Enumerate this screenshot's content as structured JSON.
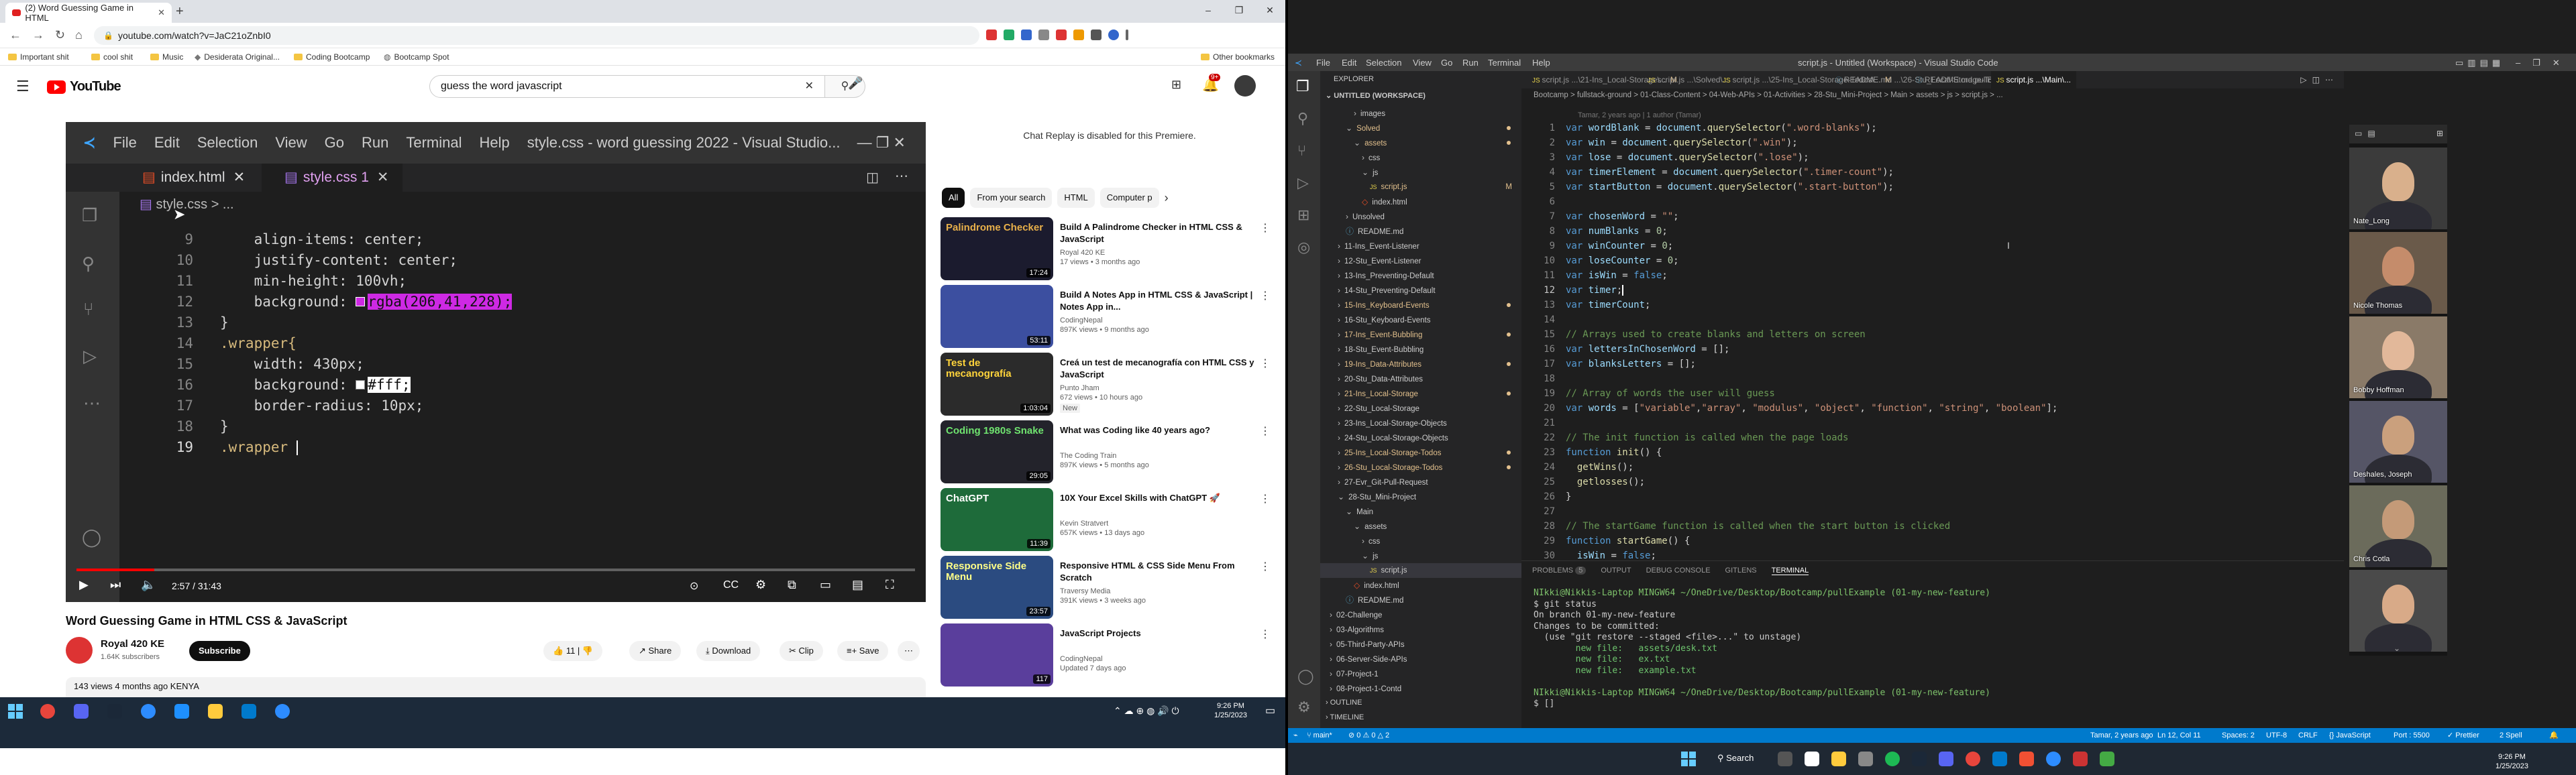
{
  "browser": {
    "tab_title": "(2) Word Guessing Game in HTML",
    "url": "youtube.com/watch?v=JaC21oZnbI0",
    "bookmarks": [
      "Important shit",
      "cool shit",
      "Music",
      "Desiderata Original...",
      "Coding Bootcamp",
      "Bootcamp Spot"
    ],
    "other_bookmarks": "Other bookmarks"
  },
  "youtube": {
    "search_query": "guess the word javascript",
    "logo_text": "YouTube",
    "notif_count": "9+",
    "video": {
      "title": "Word Guessing Game in HTML CSS & JavaScript",
      "time": "2:57 / 31:43",
      "progress": 0.093,
      "channel": "Royal 420 KE",
      "subs": "1.64K subscribers",
      "subscribe": "Subscribe",
      "likes": "11",
      "share": "Share",
      "download": "Download",
      "clip": "Clip",
      "save": "Save",
      "desc_line": "143 views  4 months ago  KENYA",
      "editor": {
        "title": "style.css - word guessing 2022 - Visual Studio...",
        "menus": [
          "File",
          "Edit",
          "Selection",
          "View",
          "Go",
          "Run",
          "Terminal",
          "Help"
        ],
        "tab1": "index.html",
        "tab2": "style.css",
        "tab2_badge": "1",
        "crumb": "style.css > ...",
        "line_numbers": [
          "9",
          "10",
          "11",
          "12",
          "13",
          "14",
          "15",
          "16",
          "17",
          "18",
          "19"
        ],
        "code_lines": [
          "    align-items: center;",
          "    justify-content: center;",
          "    min-height: 100vh;",
          "    background: ",
          "}",
          ".wrapper{",
          "    width: 430px;",
          "    background: ",
          "    border-radius: 10px;",
          "}",
          ".wrapper "
        ],
        "rgba_value": "rgba(206,41,228);",
        "hex_value": "#fff;"
      }
    },
    "chat_replay": "Chat Replay is disabled for this Premiere.",
    "chips": [
      "All",
      "From your search",
      "HTML",
      "Computer p"
    ],
    "recommendations": [
      {
        "title": "Build A Palindrome Checker in HTML CSS & JavaScript",
        "channel": "Royal 420 KE",
        "meta": "17 views • 3 months ago",
        "duration": "17:24",
        "thumb_text": "Palindrome Checker"
      },
      {
        "title": "Build A Notes App in HTML CSS & JavaScript | Notes App in...",
        "channel": "CodingNepal",
        "meta": "897K views • 9 months ago",
        "duration": "53:11",
        "thumb_text": ""
      },
      {
        "title": "Creá un test de mecanografía con HTML CSS y JavaScript",
        "channel": "Punto Jham",
        "meta": "672 views • 10 hours ago",
        "duration": "1:03:04",
        "badge": "New",
        "thumb_text": "Test de mecanografía"
      },
      {
        "title": "What was Coding like 40 years ago?",
        "channel": "The Coding Train",
        "meta": "897K views • 5 months ago",
        "duration": "29:05",
        "thumb_text": "Coding 1980s Snake"
      },
      {
        "title": "10X Your Excel Skills with ChatGPT 🚀",
        "channel": "Kevin Stratvert",
        "meta": "657K views • 13 days ago",
        "duration": "11:39",
        "thumb_text": "ChatGPT"
      },
      {
        "title": "Responsive HTML & CSS Side Menu From Scratch",
        "channel": "Traversy Media",
        "meta": "391K views • 3 weeks ago",
        "duration": "23:57",
        "thumb_text": "Responsive Side Menu"
      },
      {
        "title": "JavaScript Projects",
        "channel": "CodingNepal",
        "meta": "Updated 7 days ago",
        "duration": "117",
        "thumb_text": ""
      }
    ]
  },
  "taskbar_left": {
    "time": "9:26 PM",
    "date": "1/25/2023"
  },
  "vscode": {
    "title": "script.js - Untitled (Workspace) - Visual Studio Code",
    "menus": [
      "File",
      "Edit",
      "Selection",
      "View",
      "Go",
      "Run",
      "Terminal",
      "Help"
    ],
    "explorer_header": "EXPLORER",
    "workspace": "UNTITLED (WORKSPACE)",
    "tree": [
      {
        "label": "images",
        "depth": 3,
        "kind": "folder"
      },
      {
        "label": "Solved",
        "depth": 2,
        "kind": "folder-open",
        "color": "#e2c08d"
      },
      {
        "label": "assets",
        "depth": 3,
        "kind": "folder-open",
        "color": "#e2c08d"
      },
      {
        "label": "css",
        "depth": 4,
        "kind": "folder"
      },
      {
        "label": "js",
        "depth": 4,
        "kind": "folder-open"
      },
      {
        "label": "script.js",
        "depth": 5,
        "kind": "js",
        "color": "#e2c08d",
        "mark": "M"
      },
      {
        "label": "index.html",
        "depth": 4,
        "kind": "html"
      },
      {
        "label": "Unsolved",
        "depth": 2,
        "kind": "folder"
      },
      {
        "label": "README.md",
        "depth": 2,
        "kind": "md"
      },
      {
        "label": "11-Ins_Event-Listener",
        "depth": 1,
        "kind": "folder"
      },
      {
        "label": "12-Stu_Event-Listener",
        "depth": 1,
        "kind": "folder"
      },
      {
        "label": "13-Ins_Preventing-Default",
        "depth": 1,
        "kind": "folder"
      },
      {
        "label": "14-Stu_Preventing-Default",
        "depth": 1,
        "kind": "folder"
      },
      {
        "label": "15-Ins_Keyboard-Events",
        "depth": 1,
        "kind": "folder",
        "color": "#e2c08d"
      },
      {
        "label": "16-Stu_Keyboard-Events",
        "depth": 1,
        "kind": "folder"
      },
      {
        "label": "17-Ins_Event-Bubbling",
        "depth": 1,
        "kind": "folder",
        "color": "#e2c08d"
      },
      {
        "label": "18-Stu_Event-Bubbling",
        "depth": 1,
        "kind": "folder"
      },
      {
        "label": "19-Ins_Data-Attributes",
        "depth": 1,
        "kind": "folder",
        "color": "#e2c08d"
      },
      {
        "label": "20-Stu_Data-Attributes",
        "depth": 1,
        "kind": "folder"
      },
      {
        "label": "21-Ins_Local-Storage",
        "depth": 1,
        "kind": "folder",
        "color": "#e2c08d"
      },
      {
        "label": "22-Stu_Local-Storage",
        "depth": 1,
        "kind": "folder"
      },
      {
        "label": "23-Ins_Local-Storage-Objects",
        "depth": 1,
        "kind": "folder"
      },
      {
        "label": "24-Stu_Local-Storage-Objects",
        "depth": 1,
        "kind": "folder"
      },
      {
        "label": "25-Ins_Local-Storage-Todos",
        "depth": 1,
        "kind": "folder",
        "color": "#e2c08d"
      },
      {
        "label": "26-Stu_Local-Storage-Todos",
        "depth": 1,
        "kind": "folder",
        "color": "#e2c08d"
      },
      {
        "label": "27-Evr_Git-Pull-Request",
        "depth": 1,
        "kind": "folder"
      },
      {
        "label": "28-Stu_Mini-Project",
        "depth": 1,
        "kind": "folder-open"
      },
      {
        "label": "Main",
        "depth": 2,
        "kind": "folder-open"
      },
      {
        "label": "assets",
        "depth": 3,
        "kind": "folder-open"
      },
      {
        "label": "css",
        "depth": 4,
        "kind": "folder"
      },
      {
        "label": "js",
        "depth": 4,
        "kind": "folder-open"
      },
      {
        "label": "script.js",
        "depth": 5,
        "kind": "js",
        "active": true
      },
      {
        "label": "index.html",
        "depth": 3,
        "kind": "html"
      },
      {
        "label": "README.md",
        "depth": 2,
        "kind": "md"
      },
      {
        "label": "02-Challenge",
        "depth": 0,
        "kind": "folder"
      },
      {
        "label": "03-Algorithms",
        "depth": 0,
        "kind": "folder"
      },
      {
        "label": "05-Third-Party-APIs",
        "depth": 0,
        "kind": "folder"
      },
      {
        "label": "06-Server-Side-APIs",
        "depth": 0,
        "kind": "folder"
      },
      {
        "label": "07-Project-1",
        "depth": 0,
        "kind": "folder"
      },
      {
        "label": "08-Project-1-Contd",
        "depth": 0,
        "kind": "folder"
      }
    ],
    "outline": "OUTLINE",
    "timeline": "TIMELINE",
    "tabs": [
      {
        "label": "script.js ...\\21-Ins_Local-Storage\\...",
        "mark": "M"
      },
      {
        "label": "script.js ...\\Solved\\...",
        "mark": ""
      },
      {
        "label": "script.js ...\\25-Ins_Local-Storage-Todos\\...",
        "mark": "M"
      },
      {
        "label": "README.md ...\\26-Stu_Local-Storage-Todos",
        "mark": "1"
      },
      {
        "label": "README.md  pullExample",
        "mark": "4"
      },
      {
        "label": "script.js ...\\Main\\...",
        "mark": "",
        "active": true
      }
    ],
    "breadcrumb": "Bootcamp > fullstack-ground > 01-Class-Content > 04-Web-APIs > 01-Activities > 28-Stu_Mini-Project > Main > assets > js > script.js > ...",
    "blame": "Tamar, 2 years ago | 1 author (Tamar)",
    "code": [
      [
        [
          "kw",
          "var "
        ],
        [
          "id",
          "wordBlank"
        ],
        [
          "pu",
          " = "
        ],
        [
          "id",
          "document"
        ],
        [
          "pu",
          "."
        ],
        [
          "fn",
          "querySelector"
        ],
        [
          "pu",
          "("
        ],
        [
          "st",
          "\".word-blanks\""
        ],
        [
          "pu",
          ");"
        ]
      ],
      [
        [
          "kw",
          "var "
        ],
        [
          "id",
          "win"
        ],
        [
          "pu",
          " = "
        ],
        [
          "id",
          "document"
        ],
        [
          "pu",
          "."
        ],
        [
          "fn",
          "querySelector"
        ],
        [
          "pu",
          "("
        ],
        [
          "st",
          "\".win\""
        ],
        [
          "pu",
          ");"
        ]
      ],
      [
        [
          "kw",
          "var "
        ],
        [
          "id",
          "lose"
        ],
        [
          "pu",
          " = "
        ],
        [
          "id",
          "document"
        ],
        [
          "pu",
          "."
        ],
        [
          "fn",
          "querySelector"
        ],
        [
          "pu",
          "("
        ],
        [
          "st",
          "\".lose\""
        ],
        [
          "pu",
          ");"
        ]
      ],
      [
        [
          "kw",
          "var "
        ],
        [
          "id",
          "timerElement"
        ],
        [
          "pu",
          " = "
        ],
        [
          "id",
          "document"
        ],
        [
          "pu",
          "."
        ],
        [
          "fn",
          "querySelector"
        ],
        [
          "pu",
          "("
        ],
        [
          "st",
          "\".timer-count\""
        ],
        [
          "pu",
          ");"
        ]
      ],
      [
        [
          "kw",
          "var "
        ],
        [
          "id",
          "startButton"
        ],
        [
          "pu",
          " = "
        ],
        [
          "id",
          "document"
        ],
        [
          "pu",
          "."
        ],
        [
          "fn",
          "querySelector"
        ],
        [
          "pu",
          "("
        ],
        [
          "st",
          "\".start-button\""
        ],
        [
          "pu",
          ");"
        ]
      ],
      [],
      [
        [
          "kw",
          "var "
        ],
        [
          "id",
          "chosenWord"
        ],
        [
          "pu",
          " = "
        ],
        [
          "st",
          "\"\""
        ],
        [
          "pu",
          ";"
        ]
      ],
      [
        [
          "kw",
          "var "
        ],
        [
          "id",
          "numBlanks"
        ],
        [
          "pu",
          " = "
        ],
        [
          "nm",
          "0"
        ],
        [
          "pu",
          ";"
        ]
      ],
      [
        [
          "kw",
          "var "
        ],
        [
          "id",
          "winCounter"
        ],
        [
          "pu",
          " = "
        ],
        [
          "nm",
          "0"
        ],
        [
          "pu",
          ";"
        ]
      ],
      [
        [
          "kw",
          "var "
        ],
        [
          "id",
          "loseCounter"
        ],
        [
          "pu",
          " = "
        ],
        [
          "nm",
          "0"
        ],
        [
          "pu",
          ";"
        ]
      ],
      [
        [
          "kw",
          "var "
        ],
        [
          "id",
          "isWin"
        ],
        [
          "pu",
          " = "
        ],
        [
          "kw",
          "false"
        ],
        [
          "pu",
          ";"
        ]
      ],
      [
        [
          "kw",
          "var "
        ],
        [
          "id",
          "timer"
        ],
        [
          "pu",
          ";"
        ]
      ],
      [
        [
          "kw",
          "var "
        ],
        [
          "id",
          "timerCount"
        ],
        [
          "pu",
          ";"
        ]
      ],
      [],
      [
        [
          "cm",
          "// Arrays used to create blanks and letters on screen"
        ]
      ],
      [
        [
          "kw",
          "var "
        ],
        [
          "id",
          "lettersInChosenWord"
        ],
        [
          "pu",
          " = [];"
        ]
      ],
      [
        [
          "kw",
          "var "
        ],
        [
          "id",
          "blanksLetters"
        ],
        [
          "pu",
          " = [];"
        ]
      ],
      [],
      [
        [
          "cm",
          "// Array of words the user will guess"
        ]
      ],
      [
        [
          "kw",
          "var "
        ],
        [
          "id",
          "words"
        ],
        [
          "pu",
          " = ["
        ],
        [
          "st",
          "\"variable\""
        ],
        [
          "pu",
          ","
        ],
        [
          "st",
          "\"array\""
        ],
        [
          "pu",
          ", "
        ],
        [
          "st",
          "\"modulus\""
        ],
        [
          "pu",
          ", "
        ],
        [
          "st",
          "\"object\""
        ],
        [
          "pu",
          ", "
        ],
        [
          "st",
          "\"function\""
        ],
        [
          "pu",
          ", "
        ],
        [
          "st",
          "\"string\""
        ],
        [
          "pu",
          ", "
        ],
        [
          "st",
          "\"boolean\""
        ],
        [
          "pu",
          "];"
        ]
      ],
      [],
      [
        [
          "cm",
          "// The init function is called when the page loads"
        ]
      ],
      [
        [
          "kw",
          "function "
        ],
        [
          "fn",
          "init"
        ],
        [
          "pu",
          "() {"
        ]
      ],
      [
        [
          "pu",
          "  "
        ],
        [
          "fn",
          "getWins"
        ],
        [
          "pu",
          "();"
        ]
      ],
      [
        [
          "pu",
          "  "
        ],
        [
          "fn",
          "getlosses"
        ],
        [
          "pu",
          "();"
        ]
      ],
      [
        [
          "pu",
          "}"
        ]
      ],
      [],
      [
        [
          "cm",
          "// The startGame function is called when the start button is clicked"
        ]
      ],
      [
        [
          "kw",
          "function "
        ],
        [
          "fn",
          "startGame"
        ],
        [
          "pu",
          "() {"
        ]
      ],
      [
        [
          "pu",
          "  "
        ],
        [
          "id",
          "isWin"
        ],
        [
          "pu",
          " = "
        ],
        [
          "kw",
          "false"
        ],
        [
          "pu",
          ";"
        ]
      ]
    ],
    "panel_tabs": [
      "PROBLEMS",
      "OUTPUT",
      "DEBUG CONSOLE",
      "GITLENS",
      "TERMINAL"
    ],
    "problems_count": "5",
    "terminal": [
      "NIkki@Nikkis-Laptop MINGW64 ~/OneDrive/Desktop/Bootcamp/pullExample (01-my-new-feature)",
      "$ git status",
      "On branch 01-my-new-feature",
      "Changes to be committed:",
      "  (use \"git restore --staged <file>...\" to unstage)",
      "        new file:   assets/desk.txt",
      "        new file:   ex.txt",
      "        new file:   example.txt",
      "",
      "NIkki@Nikkis-Laptop MINGW64 ~/OneDrive/Desktop/Bootcamp/pullExample (01-my-new-feature)",
      "$ []"
    ],
    "status": {
      "branch": "main*",
      "sync": "⊘ 0 ⚠ 0 △ 2",
      "blame": "Tamar, 2 years ago",
      "pos": "Ln 12, Col 11",
      "spaces": "Spaces: 2",
      "enc": "UTF-8",
      "eol": "CRLF",
      "lang": "{} JavaScript",
      "port": "Port : 5500",
      "spell": "2 Spell"
    }
  },
  "zoom": {
    "participants": [
      "Nate_Long",
      "Nicole Thomas",
      "Bobby Hoffman",
      "Deshales, Joseph",
      "Chris Cotla",
      ""
    ]
  },
  "taskbar_right": {
    "time": "9:26 PM",
    "date": "1/25/2023",
    "search": "Search"
  }
}
